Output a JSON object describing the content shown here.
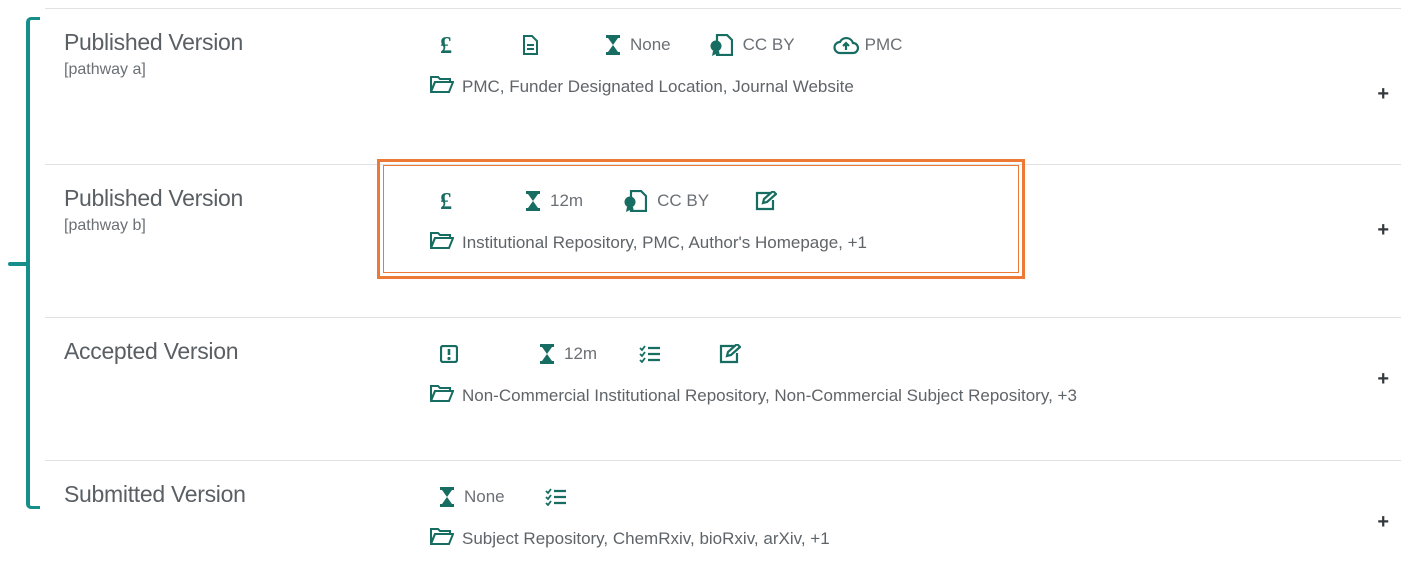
{
  "colors": {
    "accent_teal": "#168f8c",
    "icon_green": "#176d61",
    "highlight_orange": "#ec7a36"
  },
  "rows": [
    {
      "title": "Published Version",
      "subtitle": "[pathway a]",
      "icons": [
        {
          "icon": "pound-icon",
          "label": ""
        },
        {
          "icon": "document-icon",
          "label": ""
        },
        {
          "icon": "hourglass-icon",
          "label": "None"
        },
        {
          "icon": "license-icon",
          "label": "CC BY"
        },
        {
          "icon": "cloud-upload-icon",
          "label": "PMC"
        }
      ],
      "locations": "PMC, Funder Designated Location, Journal Website",
      "expand": "+"
    },
    {
      "title": "Published Version",
      "subtitle": "[pathway b]",
      "icons": [
        {
          "icon": "pound-icon",
          "label": ""
        },
        {
          "icon": "hourglass-icon",
          "label": "12m"
        },
        {
          "icon": "license-icon",
          "label": "CC BY"
        },
        {
          "icon": "edit-icon",
          "label": ""
        }
      ],
      "locations": "Institutional Repository, PMC, Author's Homepage, +1",
      "expand": "+"
    },
    {
      "title": "Accepted Version",
      "subtitle": "",
      "icons": [
        {
          "icon": "alert-icon",
          "label": ""
        },
        {
          "icon": "hourglass-icon",
          "label": "12m"
        },
        {
          "icon": "checklist-icon",
          "label": ""
        },
        {
          "icon": "edit-icon",
          "label": ""
        }
      ],
      "locations": "Non-Commercial Institutional Repository, Non-Commercial Subject Repository, +3",
      "expand": "+"
    },
    {
      "title": "Submitted Version",
      "subtitle": "",
      "icons": [
        {
          "icon": "hourglass-icon",
          "label": "None"
        },
        {
          "icon": "checklist-icon",
          "label": ""
        }
      ],
      "locations": "Subject Repository, ChemRxiv, bioRxiv, arXiv, +1",
      "expand": "+"
    }
  ]
}
